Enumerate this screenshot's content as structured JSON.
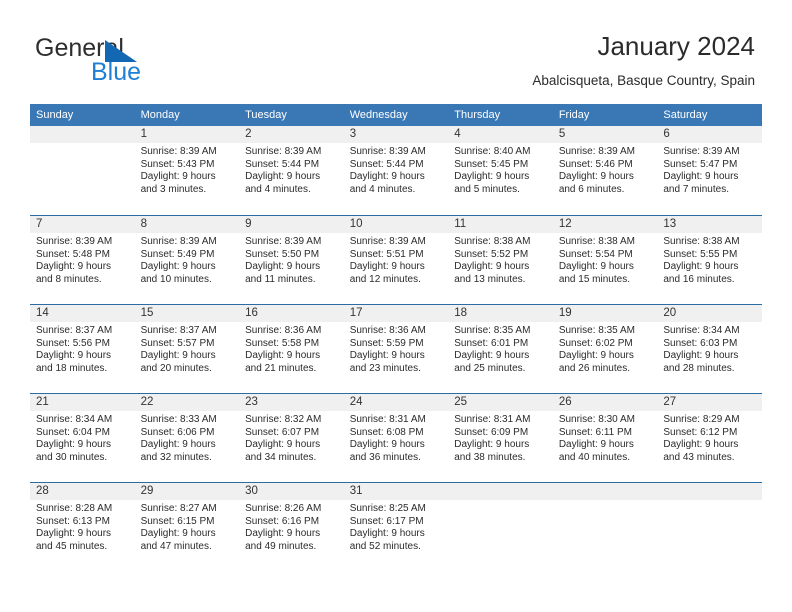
{
  "logo": {
    "primary_text": "General",
    "secondary_text": "Blue",
    "primary_color": "#2e2e2e",
    "secondary_color": "#1e7fd4",
    "triangle_color": "#1268b3"
  },
  "header": {
    "title": "January 2024",
    "subtitle": "Abalcisqueta, Basque Country, Spain"
  },
  "theme": {
    "header_row_bg": "#3a77b5",
    "header_row_text": "#ffffff",
    "daynum_band_bg": "#f0f0f0",
    "week_separator": "#2b6ca3",
    "body_text": "#2b2b2b"
  },
  "calendar": {
    "weekday_headers": [
      "Sunday",
      "Monday",
      "Tuesday",
      "Wednesday",
      "Thursday",
      "Friday",
      "Saturday"
    ],
    "weeks": [
      [
        {
          "day": ""
        },
        {
          "day": "1",
          "sunrise": "Sunrise: 8:39 AM",
          "sunset": "Sunset: 5:43 PM",
          "daylight_line1": "Daylight: 9 hours",
          "daylight_line2": "and 3 minutes."
        },
        {
          "day": "2",
          "sunrise": "Sunrise: 8:39 AM",
          "sunset": "Sunset: 5:44 PM",
          "daylight_line1": "Daylight: 9 hours",
          "daylight_line2": "and 4 minutes."
        },
        {
          "day": "3",
          "sunrise": "Sunrise: 8:39 AM",
          "sunset": "Sunset: 5:44 PM",
          "daylight_line1": "Daylight: 9 hours",
          "daylight_line2": "and 4 minutes."
        },
        {
          "day": "4",
          "sunrise": "Sunrise: 8:40 AM",
          "sunset": "Sunset: 5:45 PM",
          "daylight_line1": "Daylight: 9 hours",
          "daylight_line2": "and 5 minutes."
        },
        {
          "day": "5",
          "sunrise": "Sunrise: 8:39 AM",
          "sunset": "Sunset: 5:46 PM",
          "daylight_line1": "Daylight: 9 hours",
          "daylight_line2": "and 6 minutes."
        },
        {
          "day": "6",
          "sunrise": "Sunrise: 8:39 AM",
          "sunset": "Sunset: 5:47 PM",
          "daylight_line1": "Daylight: 9 hours",
          "daylight_line2": "and 7 minutes."
        }
      ],
      [
        {
          "day": "7",
          "sunrise": "Sunrise: 8:39 AM",
          "sunset": "Sunset: 5:48 PM",
          "daylight_line1": "Daylight: 9 hours",
          "daylight_line2": "and 8 minutes."
        },
        {
          "day": "8",
          "sunrise": "Sunrise: 8:39 AM",
          "sunset": "Sunset: 5:49 PM",
          "daylight_line1": "Daylight: 9 hours",
          "daylight_line2": "and 10 minutes."
        },
        {
          "day": "9",
          "sunrise": "Sunrise: 8:39 AM",
          "sunset": "Sunset: 5:50 PM",
          "daylight_line1": "Daylight: 9 hours",
          "daylight_line2": "and 11 minutes."
        },
        {
          "day": "10",
          "sunrise": "Sunrise: 8:39 AM",
          "sunset": "Sunset: 5:51 PM",
          "daylight_line1": "Daylight: 9 hours",
          "daylight_line2": "and 12 minutes."
        },
        {
          "day": "11",
          "sunrise": "Sunrise: 8:38 AM",
          "sunset": "Sunset: 5:52 PM",
          "daylight_line1": "Daylight: 9 hours",
          "daylight_line2": "and 13 minutes."
        },
        {
          "day": "12",
          "sunrise": "Sunrise: 8:38 AM",
          "sunset": "Sunset: 5:54 PM",
          "daylight_line1": "Daylight: 9 hours",
          "daylight_line2": "and 15 minutes."
        },
        {
          "day": "13",
          "sunrise": "Sunrise: 8:38 AM",
          "sunset": "Sunset: 5:55 PM",
          "daylight_line1": "Daylight: 9 hours",
          "daylight_line2": "and 16 minutes."
        }
      ],
      [
        {
          "day": "14",
          "sunrise": "Sunrise: 8:37 AM",
          "sunset": "Sunset: 5:56 PM",
          "daylight_line1": "Daylight: 9 hours",
          "daylight_line2": "and 18 minutes."
        },
        {
          "day": "15",
          "sunrise": "Sunrise: 8:37 AM",
          "sunset": "Sunset: 5:57 PM",
          "daylight_line1": "Daylight: 9 hours",
          "daylight_line2": "and 20 minutes."
        },
        {
          "day": "16",
          "sunrise": "Sunrise: 8:36 AM",
          "sunset": "Sunset: 5:58 PM",
          "daylight_line1": "Daylight: 9 hours",
          "daylight_line2": "and 21 minutes."
        },
        {
          "day": "17",
          "sunrise": "Sunrise: 8:36 AM",
          "sunset": "Sunset: 5:59 PM",
          "daylight_line1": "Daylight: 9 hours",
          "daylight_line2": "and 23 minutes."
        },
        {
          "day": "18",
          "sunrise": "Sunrise: 8:35 AM",
          "sunset": "Sunset: 6:01 PM",
          "daylight_line1": "Daylight: 9 hours",
          "daylight_line2": "and 25 minutes."
        },
        {
          "day": "19",
          "sunrise": "Sunrise: 8:35 AM",
          "sunset": "Sunset: 6:02 PM",
          "daylight_line1": "Daylight: 9 hours",
          "daylight_line2": "and 26 minutes."
        },
        {
          "day": "20",
          "sunrise": "Sunrise: 8:34 AM",
          "sunset": "Sunset: 6:03 PM",
          "daylight_line1": "Daylight: 9 hours",
          "daylight_line2": "and 28 minutes."
        }
      ],
      [
        {
          "day": "21",
          "sunrise": "Sunrise: 8:34 AM",
          "sunset": "Sunset: 6:04 PM",
          "daylight_line1": "Daylight: 9 hours",
          "daylight_line2": "and 30 minutes."
        },
        {
          "day": "22",
          "sunrise": "Sunrise: 8:33 AM",
          "sunset": "Sunset: 6:06 PM",
          "daylight_line1": "Daylight: 9 hours",
          "daylight_line2": "and 32 minutes."
        },
        {
          "day": "23",
          "sunrise": "Sunrise: 8:32 AM",
          "sunset": "Sunset: 6:07 PM",
          "daylight_line1": "Daylight: 9 hours",
          "daylight_line2": "and 34 minutes."
        },
        {
          "day": "24",
          "sunrise": "Sunrise: 8:31 AM",
          "sunset": "Sunset: 6:08 PM",
          "daylight_line1": "Daylight: 9 hours",
          "daylight_line2": "and 36 minutes."
        },
        {
          "day": "25",
          "sunrise": "Sunrise: 8:31 AM",
          "sunset": "Sunset: 6:09 PM",
          "daylight_line1": "Daylight: 9 hours",
          "daylight_line2": "and 38 minutes."
        },
        {
          "day": "26",
          "sunrise": "Sunrise: 8:30 AM",
          "sunset": "Sunset: 6:11 PM",
          "daylight_line1": "Daylight: 9 hours",
          "daylight_line2": "and 40 minutes."
        },
        {
          "day": "27",
          "sunrise": "Sunrise: 8:29 AM",
          "sunset": "Sunset: 6:12 PM",
          "daylight_line1": "Daylight: 9 hours",
          "daylight_line2": "and 43 minutes."
        }
      ],
      [
        {
          "day": "28",
          "sunrise": "Sunrise: 8:28 AM",
          "sunset": "Sunset: 6:13 PM",
          "daylight_line1": "Daylight: 9 hours",
          "daylight_line2": "and 45 minutes."
        },
        {
          "day": "29",
          "sunrise": "Sunrise: 8:27 AM",
          "sunset": "Sunset: 6:15 PM",
          "daylight_line1": "Daylight: 9 hours",
          "daylight_line2": "and 47 minutes."
        },
        {
          "day": "30",
          "sunrise": "Sunrise: 8:26 AM",
          "sunset": "Sunset: 6:16 PM",
          "daylight_line1": "Daylight: 9 hours",
          "daylight_line2": "and 49 minutes."
        },
        {
          "day": "31",
          "sunrise": "Sunrise: 8:25 AM",
          "sunset": "Sunset: 6:17 PM",
          "daylight_line1": "Daylight: 9 hours",
          "daylight_line2": "and 52 minutes."
        },
        {
          "day": ""
        },
        {
          "day": ""
        },
        {
          "day": ""
        }
      ]
    ]
  }
}
